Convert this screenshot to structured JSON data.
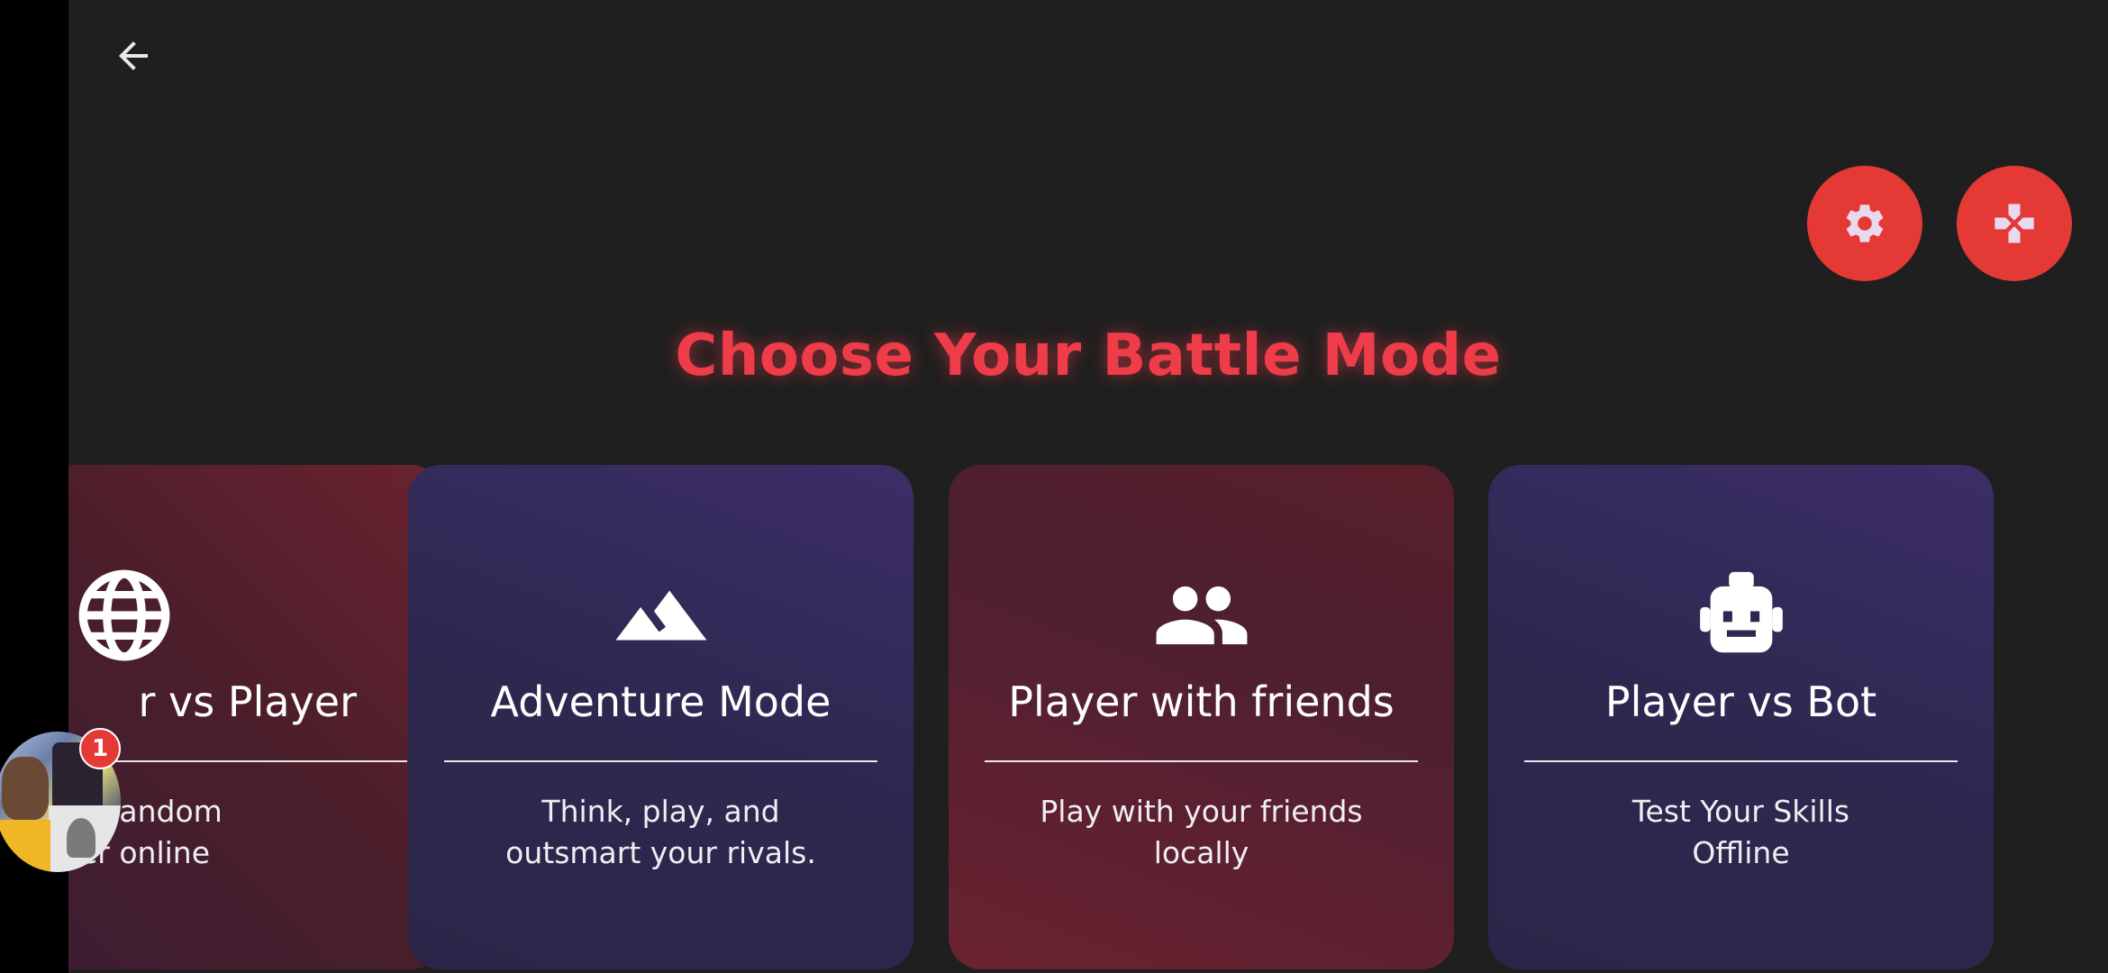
{
  "header": {
    "back_icon": "arrow-left-icon"
  },
  "fabs": [
    {
      "icon": "gear-icon",
      "color": "#e53935"
    },
    {
      "icon": "gamepad-icon",
      "color": "#e53935"
    }
  ],
  "title": "Choose Your Battle Mode",
  "title_color": "#ee3c48",
  "cards": [
    {
      "icon": "globe-icon",
      "name": "r vs Player",
      "desc_line1": "e random",
      "desc_line2": "er online"
    },
    {
      "icon": "mountain-icon",
      "name": "Adventure Mode",
      "desc_line1": "Think, play, and",
      "desc_line2": "outsmart your rivals."
    },
    {
      "icon": "people-icon",
      "name": "Player with friends",
      "desc_line1": "Play with your friends",
      "desc_line2": "locally"
    },
    {
      "icon": "robot-icon",
      "name": "Player vs Bot",
      "desc_line1": "Test Your Skills",
      "desc_line2": "Offline"
    }
  ],
  "chat_bubble": {
    "badge": "1"
  }
}
